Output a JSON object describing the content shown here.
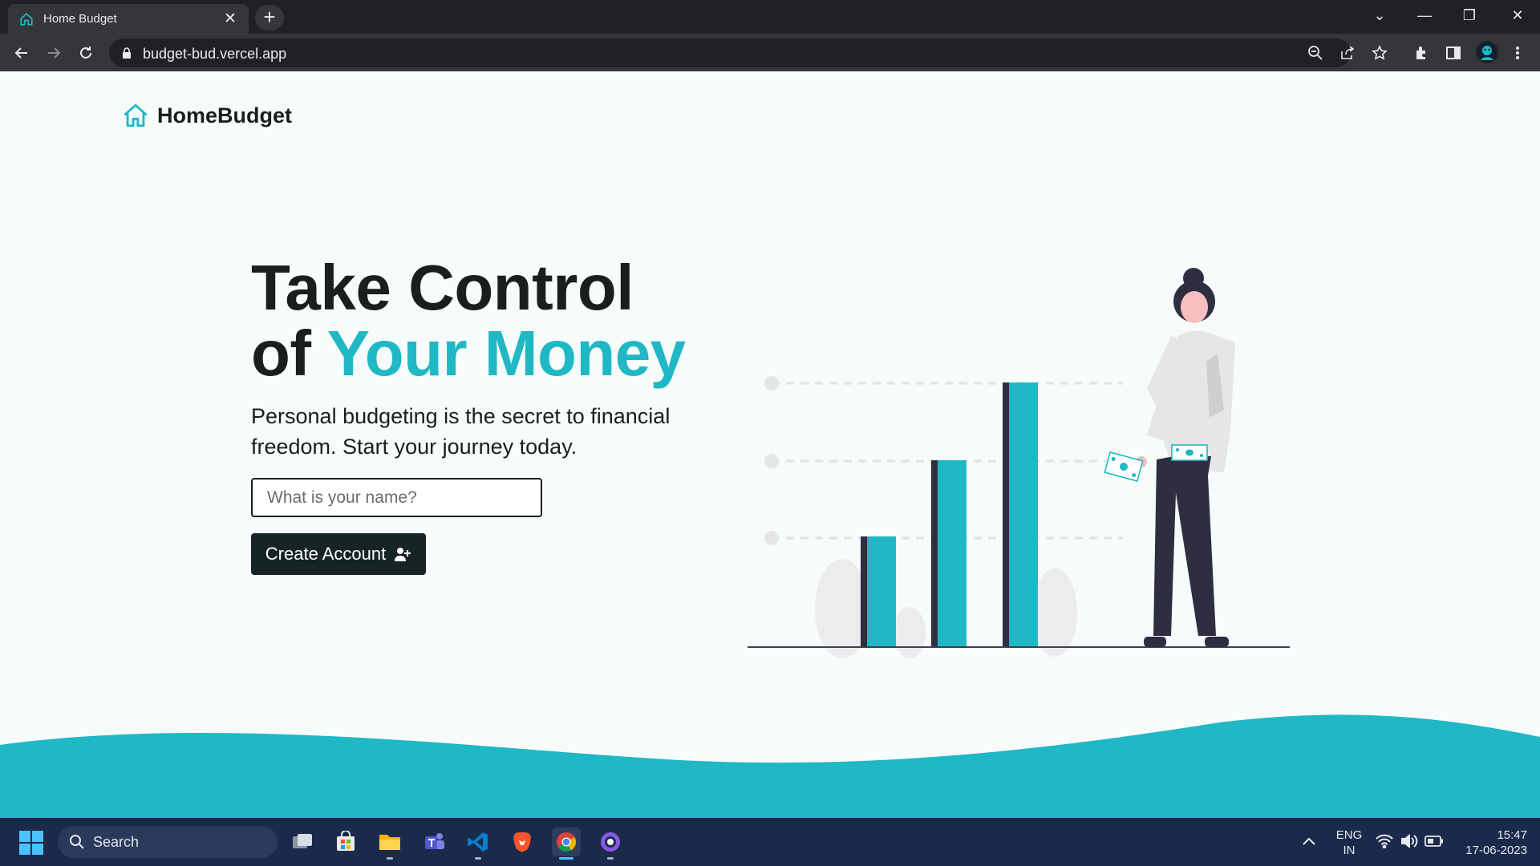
{
  "browser": {
    "tab_title": "Home Budget",
    "url": "budget-bud.vercel.app"
  },
  "page": {
    "logo_text": "HomeBudget",
    "headline_line1": "Take Control",
    "headline_of": "of",
    "headline_accent": "Your Money",
    "subtitle": "Personal budgeting is the secret to financial freedom. Start your journey today.",
    "name_placeholder": "What is your name?",
    "create_button_label": "Create Account",
    "accent_color": "#1fb8c4",
    "dark_color": "#172426"
  },
  "taskbar": {
    "search_label": "Search",
    "language_line1": "ENG",
    "language_line2": "IN",
    "time": "15:47",
    "date": "17-06-2023",
    "apps": [
      "task-view",
      "microsoft-store",
      "file-explorer",
      "teams",
      "vscode",
      "brave",
      "chrome",
      "github-desktop"
    ]
  }
}
